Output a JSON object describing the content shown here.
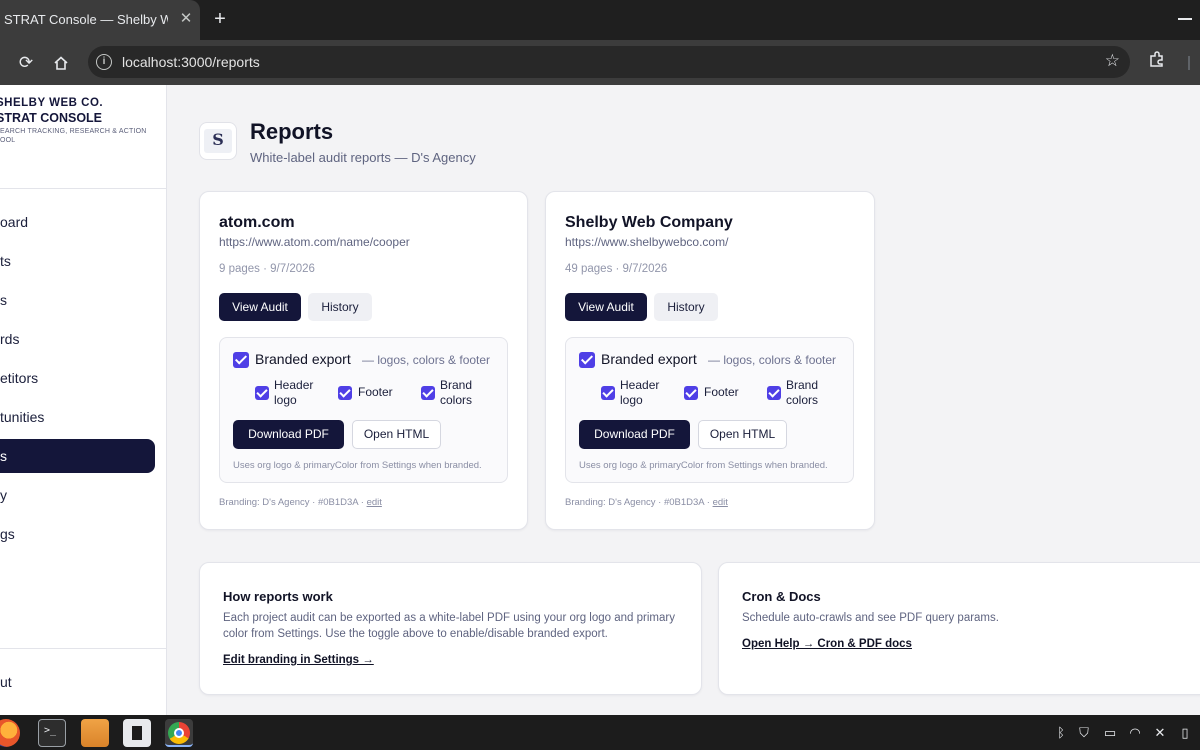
{
  "browser": {
    "tab_title": "STRAT Console — Shelby Web Co.",
    "url": "localhost:3000/reports"
  },
  "sidebar": {
    "brand_line1": "SHELBY WEB CO.",
    "brand_line2": "STRAT CONSOLE",
    "brand_line3a": "EARCH TRACKING, RESEARCH & ACTION",
    "brand_line3b": "OOL",
    "items": [
      {
        "label": "oard"
      },
      {
        "label": "ts"
      },
      {
        "label": "s"
      },
      {
        "label": "rds"
      },
      {
        "label": "etitors"
      },
      {
        "label": "tunities"
      },
      {
        "label": "s"
      },
      {
        "label": "y"
      },
      {
        "label": "gs"
      }
    ],
    "logout_label": "ut"
  },
  "header": {
    "title": "Reports",
    "subtitle": "White-label audit reports — D's Agency",
    "logo_glyph": "S"
  },
  "reports": [
    {
      "title": "atom.com",
      "url": "https://www.atom.com/name/cooper",
      "meta": "9 pages · 9/7/2026",
      "view_label": "View Audit",
      "history_label": "History",
      "export_label": "Branded export",
      "export_hint": "— logos, colors & footer",
      "opt1": "Header logo",
      "opt1a": "Header",
      "opt1b": "logo",
      "opt2": "Footer",
      "opt3a": "Brand",
      "opt3b": "colors",
      "pdf_label": "Download PDF",
      "html_label": "Open HTML",
      "note": "Uses org logo & primaryColor from Settings when branded.",
      "branding": "Branding: D's Agency · #0B1D3A · ",
      "edit": "edit"
    },
    {
      "title": "Shelby Web Company",
      "url": "https://www.shelbywebco.com/",
      "meta": "49 pages · 9/7/2026",
      "view_label": "View Audit",
      "history_label": "History",
      "export_label": "Branded export",
      "export_hint": "— logos, colors & footer",
      "opt1a": "Header",
      "opt1b": "logo",
      "opt2": "Footer",
      "opt3a": "Brand",
      "opt3b": "colors",
      "pdf_label": "Download PDF",
      "html_label": "Open HTML",
      "note": "Uses org logo & primaryColor from Settings when branded.",
      "branding": "Branding: D's Agency · #0B1D3A · ",
      "edit": "edit"
    }
  ],
  "how": {
    "title": "How reports work",
    "body": "Each project audit can be exported as a white-label PDF using your org logo and primary color from Settings. Use the toggle above to enable/disable branded export.",
    "link": "Edit branding in Settings →"
  },
  "cron": {
    "title": "Cron & Docs",
    "body": "Schedule auto-crawls and see PDF query params.",
    "link": "Open Help → Cron & PDF docs"
  },
  "colors": {
    "primary": "#14163a",
    "checkbox": "#4f3fe6",
    "brand_color": "#0B1D3A"
  }
}
